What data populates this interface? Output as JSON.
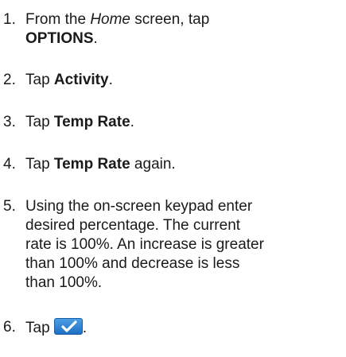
{
  "steps": [
    {
      "number": "1.",
      "text_before": "From the ",
      "emphasis": "Home",
      "text_middle": " screen, tap",
      "bold": "OPTIONS",
      "text_after": "."
    },
    {
      "number": "2.",
      "text_before": "Tap ",
      "bold": "Activity",
      "text_after": "."
    },
    {
      "number": "3.",
      "text_before": "Tap ",
      "bold": "Temp Rate",
      "text_after": "."
    },
    {
      "number": "4.",
      "text_before": "Tap ",
      "bold": "Temp Rate",
      "text_after": " again."
    },
    {
      "number": "5.",
      "line1": "Using the on-screen keypad enter",
      "line2": "desired percentage. The current",
      "line3": "rate is 100%. An increase is greater",
      "line4": "than 100% and decrease is less",
      "line5": "than 100%."
    },
    {
      "number": "6.",
      "text_before": "Tap ",
      "icon": "checkmark-button-icon",
      "text_after": "."
    }
  ],
  "colors": {
    "text": "#1a1a1a",
    "button_top": "#4b9fe3",
    "button_bottom": "#1f6fc4"
  }
}
